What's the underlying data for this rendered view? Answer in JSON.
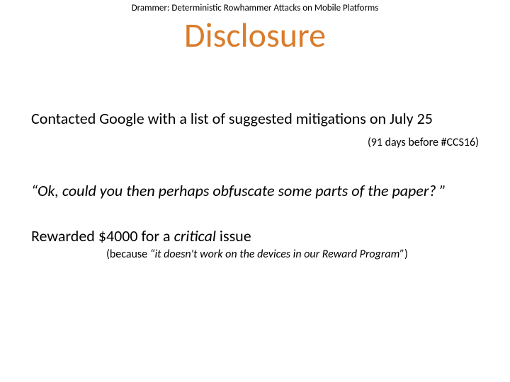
{
  "header": "Drammer: Deterministic Rowhammer Attacks on Mobile Platforms",
  "title": "Disclosure",
  "line1": "Contacted Google with a list of suggested mitigations on July 25",
  "note1": "(91 days before #CCS16)",
  "quote1": "“Ok, could you then perhaps obfuscate some parts of the paper? ”",
  "line2_pre": "Rewarded $4000 for a ",
  "line2_crit": "critical",
  "line2_post": " issue",
  "note2_pre": "(because ",
  "note2_inner": "“it doesn't work on the devices in our Reward  Program”",
  "note2_post": ")"
}
